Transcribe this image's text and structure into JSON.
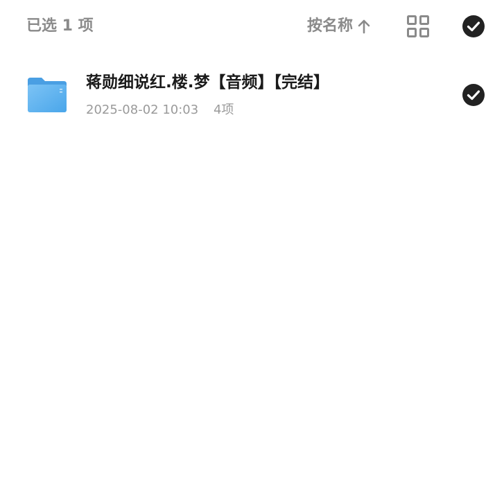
{
  "header": {
    "selected_label": "已选 1 项",
    "sort_label": "按名称",
    "sort_direction_icon": "arrow-up-icon",
    "view_toggle_icon": "grid-view-icon",
    "select_all_icon": "check-circle-icon"
  },
  "files": [
    {
      "name": "蒋勋细说红.楼.梦【音频】【完结】",
      "date": "2025-08-02 10:03",
      "count": "4项",
      "type_icon": "folder-icon",
      "selected": true
    }
  ],
  "colors": {
    "muted_text": "#8a8a8a",
    "title_text": "#1a1a1a",
    "check_fill": "#222222",
    "folder_blue": "#64b5f0"
  }
}
